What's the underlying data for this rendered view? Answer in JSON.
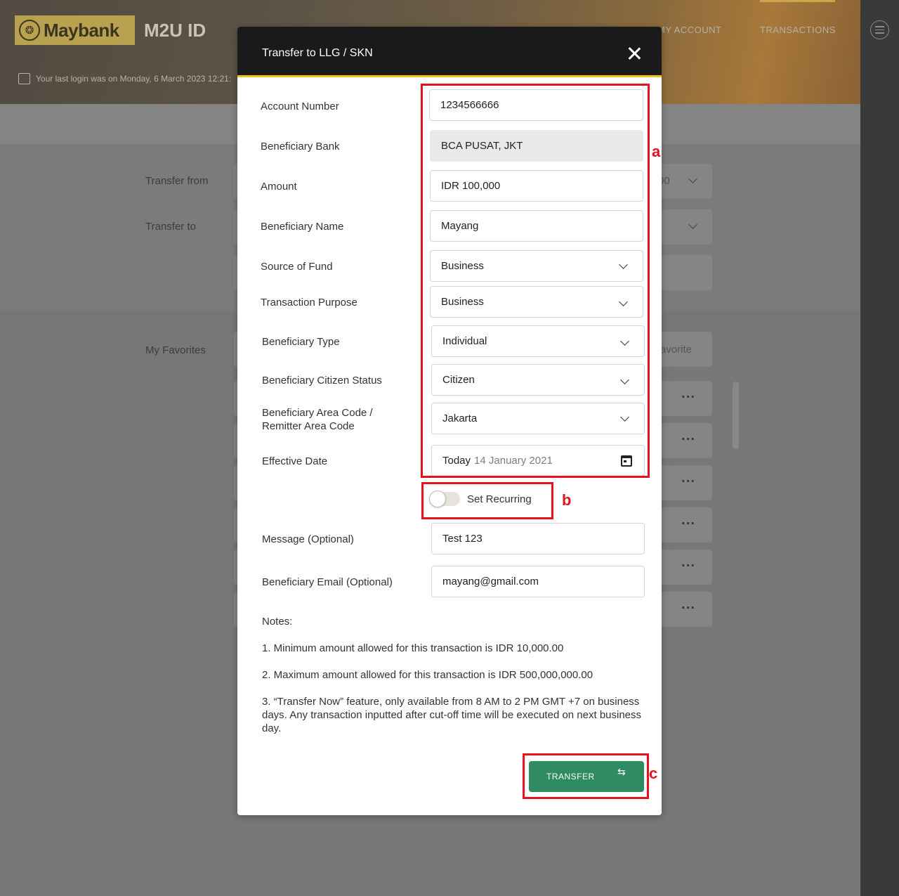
{
  "header": {
    "brand": "Maybank",
    "product": "M2U ID",
    "last_login": "Your last login was on Monday, 6 March 2023 12:21:",
    "nav": [
      "MY ACCOUNT",
      "TRANSACTIONS"
    ],
    "icons": [
      "tiger-logo-icon",
      "calendar-clock-icon",
      "hamburger-menu-icon"
    ]
  },
  "background_form": {
    "transfer_from_label": "Transfer from",
    "transfer_from_value_fragment": "00",
    "transfer_to_label": "Transfer to",
    "favorites_label": "My Favorites",
    "favorite_button_fragment": "avorite"
  },
  "modal": {
    "title": "Transfer to LLG / SKN",
    "fields": {
      "account_number": {
        "label": "Account Number",
        "value": "1234566666"
      },
      "beneficiary_bank": {
        "label": "Beneficiary Bank",
        "value": "BCA PUSAT, JKT"
      },
      "amount": {
        "label": "Amount",
        "value": "IDR 100,000"
      },
      "beneficiary_name": {
        "label": "Beneficiary Name",
        "value": "Mayang"
      },
      "source_of_fund": {
        "label": "Source of Fund",
        "value": "Business"
      },
      "transaction_purpose": {
        "label": "Transaction Purpose",
        "value": "Business"
      },
      "beneficiary_type": {
        "label": "Beneficiary Type",
        "value": "Individual"
      },
      "citizen_status": {
        "label": "Beneficiary Citizen Status",
        "value": "Citizen"
      },
      "area_code": {
        "label_line1": "Beneficiary Area Code /",
        "label_line2": "Remitter Area Code",
        "value": "Jakarta"
      },
      "effective_date": {
        "label": "Effective Date",
        "value_prefix": "Today",
        "value_date": "14 January 2021"
      },
      "message": {
        "label": "Message (Optional)",
        "value": "Test 123"
      },
      "email": {
        "label": "Beneficiary Email (Optional)",
        "value": "mayang@gmail.com"
      }
    },
    "recurring": {
      "label": "Set Recurring",
      "enabled": false
    },
    "notes": {
      "heading": "Notes:",
      "items": [
        "1. Minimum amount allowed for this transaction is IDR 10,000.00",
        "2. Maximum amount allowed for this transaction is IDR 500,000,000.00",
        "3. “Transfer Now” feature, only available from 8 AM to 2 PM GMT +7 on business days. Any transaction inputted after cut-off time will be executed on next business day."
      ]
    },
    "transfer_button": "TRANSFER"
  },
  "annotations": {
    "a": "a",
    "b": "b",
    "c": "c"
  },
  "colors": {
    "header_bg": "#1a1a1a",
    "accent_yellow": "#f2c21a",
    "button_green": "#2e8b62",
    "annotation_red": "#e4131f",
    "readonly_bg": "#e9e9e9"
  }
}
